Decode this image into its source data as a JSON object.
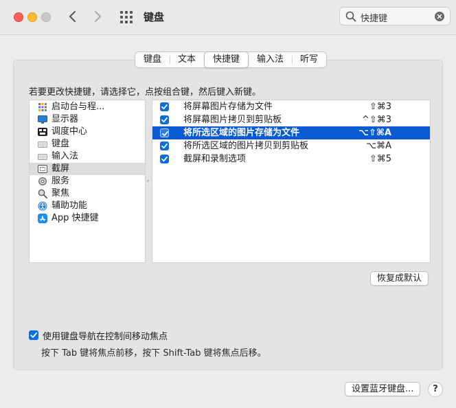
{
  "window": {
    "title": "键盘",
    "search_value": "快捷键"
  },
  "tabs": [
    {
      "label": "键盘",
      "active": false
    },
    {
      "label": "文本",
      "active": false
    },
    {
      "label": "快捷键",
      "active": true
    },
    {
      "label": "输入法",
      "active": false
    },
    {
      "label": "听写",
      "active": false
    }
  ],
  "instruction": "若要更改快捷键，请选择它，点按组合键，然后键入新键。",
  "categories": [
    {
      "label": "启动台与程...",
      "icon": "launchpad-icon"
    },
    {
      "label": "显示器",
      "icon": "display-icon"
    },
    {
      "label": "调度中心",
      "icon": "mission-control-icon"
    },
    {
      "label": "键盘",
      "icon": "keyboard-icon"
    },
    {
      "label": "输入法",
      "icon": "input-method-icon"
    },
    {
      "label": "截屏",
      "icon": "screenshot-icon",
      "selected": true
    },
    {
      "label": "服务",
      "icon": "services-gear-icon"
    },
    {
      "label": "聚焦",
      "icon": "spotlight-icon"
    },
    {
      "label": "辅助功能",
      "icon": "accessibility-icon"
    },
    {
      "label": "App 快捷键",
      "icon": "app-store-icon"
    }
  ],
  "shortcuts": [
    {
      "label": "将屏幕图片存储为文件",
      "key": "⇧⌘3",
      "checked": true
    },
    {
      "label": "将屏幕图片拷贝到剪贴板",
      "key": "^⇧⌘3",
      "checked": true
    },
    {
      "label": "将所选区域的图片存储为文件",
      "key": "⌥⇧⌘A",
      "checked": true,
      "selected": true
    },
    {
      "label": "将所选区域的图片拷贝到剪贴板",
      "key": "⌥⌘A",
      "checked": true
    },
    {
      "label": "截屏和录制选项",
      "key": "⇧⌘5",
      "checked": true
    }
  ],
  "restore_button": "恢复成默认",
  "keyboard_nav": {
    "checked": true,
    "label": "使用键盘导航在控制间移动焦点",
    "hint": "按下 Tab 键将焦点前移，按下 Shift-Tab 键将焦点后移。"
  },
  "bluetooth_button": "设置蓝牙键盘...",
  "help_label": "?",
  "colors": {
    "accent": "#0b6ee0",
    "selection": "#0a5bd1"
  }
}
